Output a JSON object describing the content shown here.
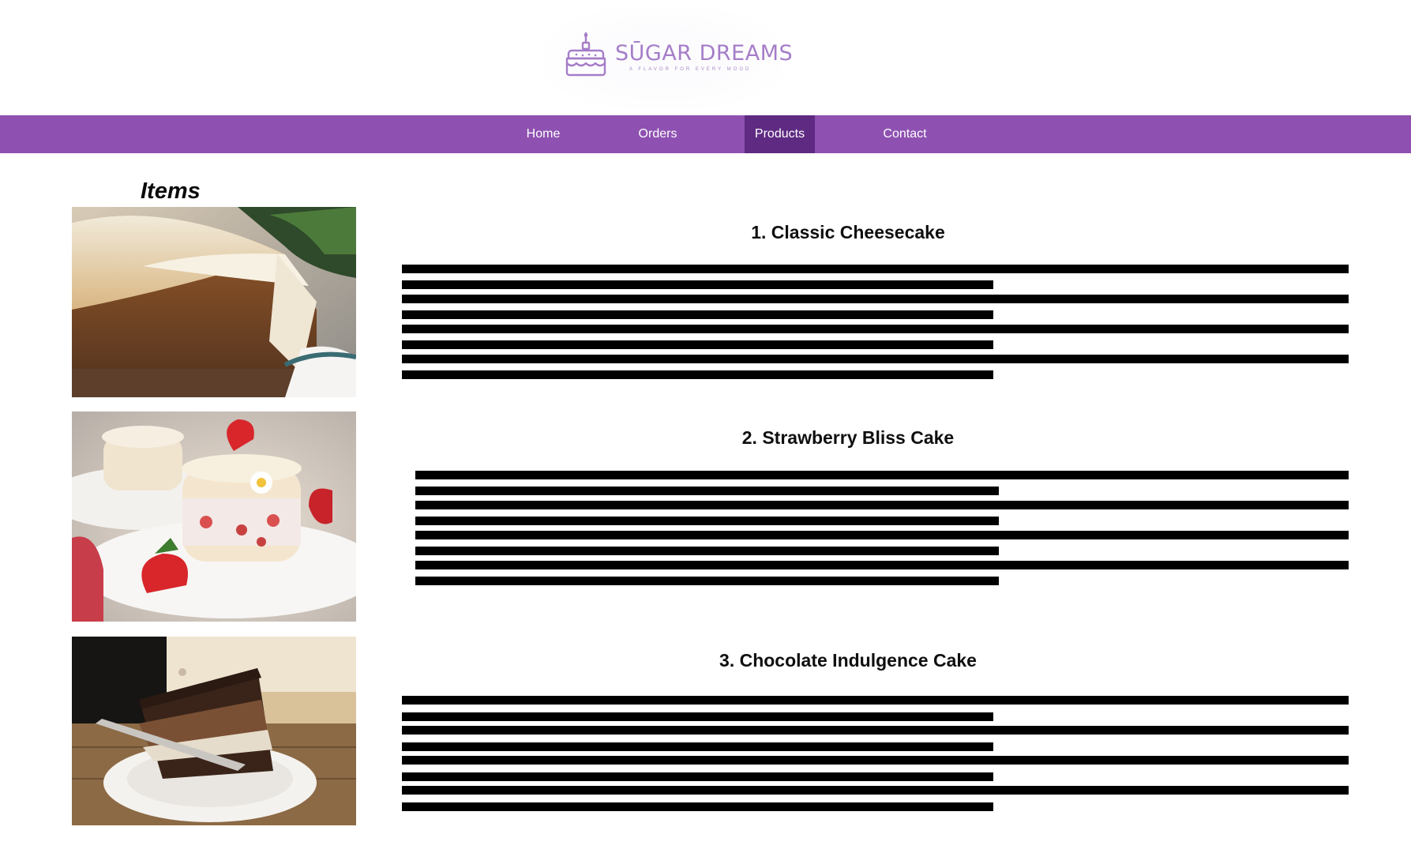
{
  "logo": {
    "title": "SŪGAR DREAMS",
    "tagline": "A FLAVOR FOR EVERY MOOD",
    "color": "#a57dc8"
  },
  "nav": {
    "items": [
      {
        "label": "Home"
      },
      {
        "label": "Orders"
      },
      {
        "label": "Products"
      },
      {
        "label": "Contact"
      }
    ],
    "active": "Products",
    "background": "#8e51b1",
    "active_background": "#5e2a82"
  },
  "items_heading": "Items",
  "products": [
    {
      "title": "1. Classic Cheesecake",
      "image": "cheesecake-photo"
    },
    {
      "title": "2. Strawberry Bliss Cake",
      "image": "strawberry-cake-photo"
    },
    {
      "title": "3. Chocolate Indulgence Cake",
      "image": "chocolate-cake-photo"
    }
  ]
}
